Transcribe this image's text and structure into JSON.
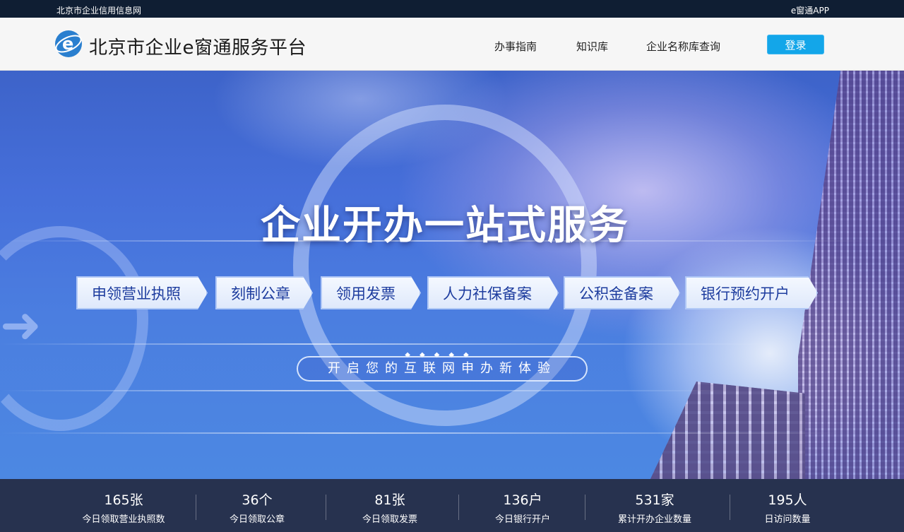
{
  "topstrip": {
    "left_text": "北京市企业信用信息网",
    "right_text": "e窗通APP"
  },
  "header": {
    "logo_text": "北京市企业e窗通服务平台",
    "nav": [
      {
        "label": "办事指南"
      },
      {
        "label": "知识库"
      },
      {
        "label": "企业名称库查询"
      }
    ],
    "login_label": "登录"
  },
  "hero": {
    "title": "企业开办一站式服务",
    "services": [
      {
        "label": "申领营业执照"
      },
      {
        "label": "刻制公章"
      },
      {
        "label": "领用发票"
      },
      {
        "label": "人力社保备案"
      },
      {
        "label": "公积金备案"
      },
      {
        "label": "银行预约开户"
      }
    ],
    "slogan": "开启您的互联网申办新体验"
  },
  "stats": [
    {
      "value": "165张",
      "label": "今日领取营业执照数"
    },
    {
      "value": "36个",
      "label": "今日领取公章"
    },
    {
      "value": "81张",
      "label": "今日领取发票"
    },
    {
      "value": "136户",
      "label": "今日银行开户"
    },
    {
      "value": "531家",
      "label": "累计开办企业数量"
    },
    {
      "value": "195人",
      "label": "日访问数量"
    }
  ],
  "colors": {
    "top_strip": "#0f1e33",
    "login_button": "#13a6e9",
    "stats_bar": "#27324f",
    "service_text": "#1d3c9e"
  }
}
